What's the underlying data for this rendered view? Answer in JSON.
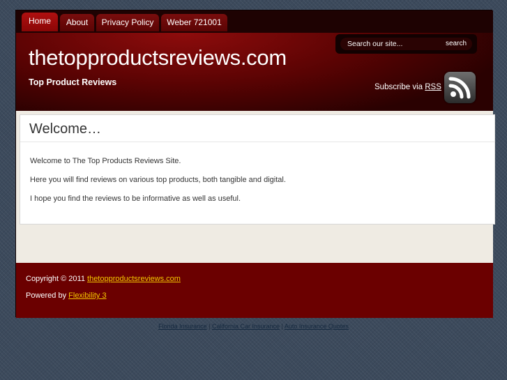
{
  "nav": {
    "tabs": [
      {
        "label": "Home",
        "active": true
      },
      {
        "label": "About",
        "active": false
      },
      {
        "label": "Privacy Policy",
        "active": false
      },
      {
        "label": "Weber 721001",
        "active": false
      }
    ]
  },
  "header": {
    "site_title": "thetopproductsreviews.com",
    "tagline": "Top Product Reviews",
    "search_placeholder": "Search our site...",
    "search_button": "search",
    "subscribe_text": "Subscribe via ",
    "subscribe_link": "RSS"
  },
  "post": {
    "title": "Welcome…",
    "paragraphs": [
      "Welcome to The Top Products Reviews Site.",
      "Here you will find reviews on various top products, both tangible and digital.",
      "I hope you find the reviews to be informative as well as useful."
    ]
  },
  "footer": {
    "copyright_text": "Copyright © 2011 ",
    "copyright_link": "thetopproductsreviews.com",
    "powered_text": "Powered by ",
    "powered_link": "Flexibility 3"
  },
  "bottom_links": {
    "items": [
      "Florida Insurance",
      "California Car Insurance",
      "Auto Insurance Quotes"
    ],
    "separator": " | "
  },
  "colors": {
    "header_red": "#8e0c0c",
    "footer_red": "#6b0000",
    "link_yellow": "#f6c800",
    "page_background": "#3c4a5c"
  }
}
